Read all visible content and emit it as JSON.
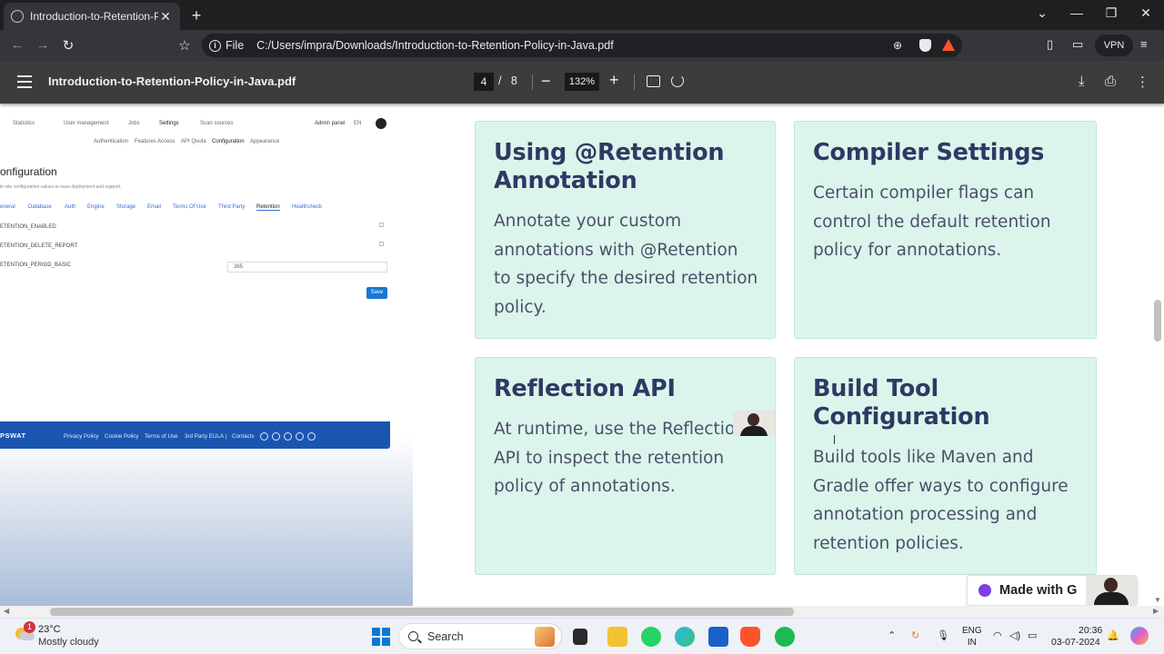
{
  "browser": {
    "tab_title": "Introduction-to-Retention-Policy-in-Java.pdf",
    "tab_close": "✕",
    "new_tab": "+",
    "window_controls": [
      "⌄",
      "—",
      "❐",
      "✕"
    ],
    "nav": [
      "←",
      "→",
      "↻"
    ],
    "bookmark": "☆",
    "address_prefix": "File",
    "address": "C:/Users/impra/Downloads/Introduction-to-Retention-Policy-in-Java.pdf",
    "vpn_label": "VPN"
  },
  "pdf_toolbar": {
    "menu_icon": "hamburger-icon",
    "title": "Introduction-to-Retention-Policy-in-Java.pdf",
    "current_page": "4",
    "page_separator": "/",
    "total_pages": "8",
    "zoom_out": "−",
    "zoom": "132%",
    "zoom_in": "+",
    "download": "⤓",
    "print": "⎙",
    "more": "⋮"
  },
  "embedded_screenshot": {
    "nav": [
      "Statistics",
      "User management",
      "Jobs",
      "Settings",
      "Scan sources"
    ],
    "admin_panel": "Admin panel",
    "lang": "EN",
    "subnav": [
      "Authentication",
      "Features Access",
      "API Quota",
      "Configuration",
      "Appearance"
    ],
    "heading": "onfiguration",
    "subheading": "te site configuration values to ease deployment and support.",
    "tabs": [
      "eneral",
      "Database",
      "Auth",
      "Engine",
      "Storage",
      "Email",
      "Terms Of Use",
      "Third Party",
      "Retention",
      "Healthcheck"
    ],
    "fields": [
      "ETENTION_ENABLED",
      "ETENTION_DELETE_REPORT",
      "ETENTION_PERIOD_BASIC"
    ],
    "period_value": "365",
    "save_label": "Save",
    "footer_logo": "PSWAT",
    "footer_links": [
      "Privacy Policy",
      "Cookie Policy",
      "Terms of Use",
      "3rd Party EULA",
      "|",
      "Contacts"
    ]
  },
  "cards": [
    {
      "title_lines": [
        "Using @Retention",
        "Annotation"
      ],
      "body_lines": [
        "Annotate your custom",
        "annotations with @Retention",
        "to specify the desired retention",
        "policy."
      ]
    },
    {
      "title_lines": [
        "Compiler Settings"
      ],
      "body_lines": [
        "Certain compiler flags can",
        "control the default retention",
        "policy for annotations."
      ]
    },
    {
      "title_lines": [
        "Reflection API"
      ],
      "body_lines": [
        "At runtime, use the Reflectio",
        "API to inspect the retention",
        "policy of annotations."
      ]
    },
    {
      "title_lines": [
        "Build Tool",
        "Configuration"
      ],
      "body_lines": [
        "Build tools like Maven and",
        "Gradle offer ways to configure",
        "annotation processing and",
        "retention policies."
      ]
    }
  ],
  "made_with": "Made with G",
  "taskbar": {
    "weather_badge": "1",
    "temperature": "23°C",
    "condition": "Mostly cloudy",
    "search_placeholder": "Search",
    "lang_top": "ENG",
    "lang_bottom": "IN",
    "time": "20:36",
    "date": "03-07-2024",
    "tray_icons": [
      "chevron-up-icon",
      "refresh-icon",
      "mic-icon",
      "wifi-icon",
      "speaker-icon",
      "battery-icon",
      "bell-icon",
      "copilot-icon"
    ]
  },
  "colors": {
    "card_bg": "#dcf5ec",
    "card_title": "#2d3a63",
    "card_text": "#4a5068",
    "pdf_toolbar": "#3c3c3c",
    "accent_blue": "#1a56b0"
  }
}
